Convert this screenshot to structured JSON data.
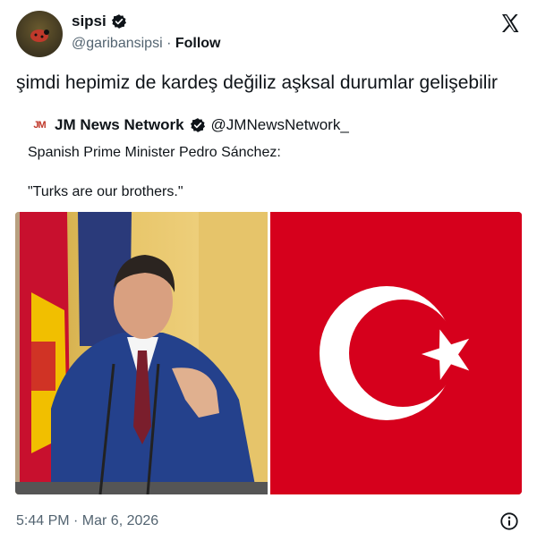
{
  "author": {
    "display_name": "sipsi",
    "handle": "@garibansipsi",
    "separator": " · ",
    "follow_label": "Follow"
  },
  "tweet": {
    "text": "şimdi hepimiz de kardeş değiliz aşksal durumlar gelişebilir",
    "timestamp": "5:44 PM · Mar 6, 2026"
  },
  "quoted": {
    "logo_text": "JM",
    "display_name": "JM News Network",
    "handle": "@JMNewsNetwork_",
    "line1": "Spanish Prime Minister Pedro Sánchez:",
    "line2": "\"Turks are our brothers.\""
  },
  "media": [
    {
      "icon": "speaker-at-podium-photo"
    },
    {
      "icon": "turkish-flag-image"
    }
  ],
  "icons": {
    "platform": "x-logo-icon",
    "verified": "verified-badge-icon",
    "info": "info-icon"
  },
  "colors": {
    "verified_badge": "#0f1419",
    "flag_red": "#d6001c",
    "secondary_text": "#536471"
  }
}
